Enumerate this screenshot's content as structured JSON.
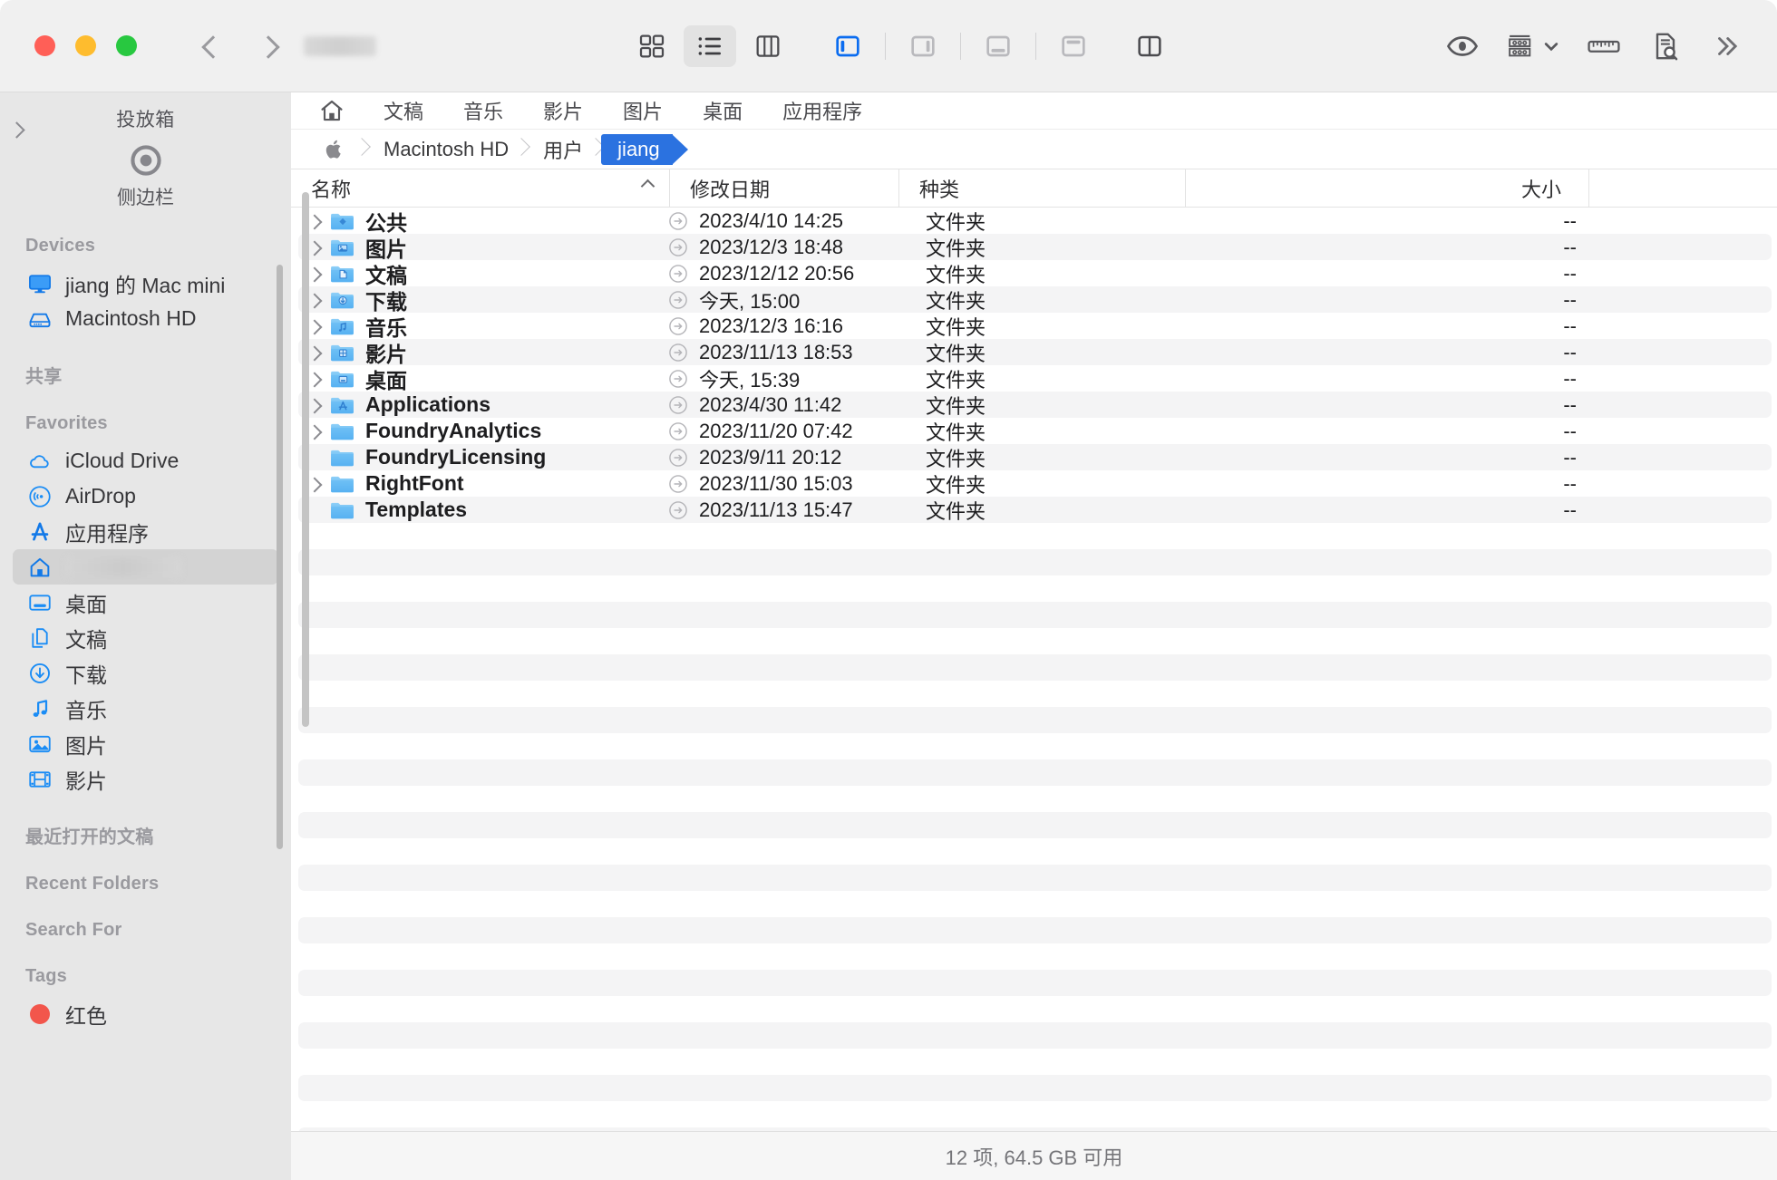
{
  "window": {
    "traffic_lights": [
      "close",
      "minimize",
      "zoom"
    ],
    "title_redacted": true
  },
  "toolbar": {
    "back_label": "后退",
    "forward_label": "前进",
    "view_buttons": [
      {
        "name": "icon-view",
        "label": "图标显示",
        "active": false
      },
      {
        "name": "list-view",
        "label": "列表显示",
        "active": true
      },
      {
        "name": "column-view",
        "label": "分栏显示",
        "active": false
      }
    ],
    "pane_buttons": [
      {
        "name": "sidebar-left-toggle",
        "label": "左侧边栏",
        "active": true
      },
      {
        "name": "sidebar-right-toggle",
        "label": "右侧边栏",
        "active": false
      },
      {
        "name": "bottom-pane-toggle",
        "label": "底部面板",
        "active": false
      },
      {
        "name": "top-pane-toggle",
        "label": "顶部面板",
        "active": false
      },
      {
        "name": "split-pane-toggle",
        "label": "双栏",
        "active": false
      }
    ],
    "right_buttons": [
      {
        "name": "quick-look",
        "label": "快速查看"
      },
      {
        "name": "group-by",
        "label": "分组方式"
      },
      {
        "name": "measure",
        "label": "标尺"
      },
      {
        "name": "document-search",
        "label": "文稿搜索"
      },
      {
        "name": "more",
        "label": "更多"
      }
    ]
  },
  "sidebar": {
    "dropbox_title": "投放箱",
    "dropbox_subtitle": "侧边栏",
    "sections": [
      {
        "title": "Devices",
        "items": [
          {
            "icon": "display-icon",
            "label": "jiang 的 Mac mini",
            "selected": false
          },
          {
            "icon": "harddisk-icon",
            "label": "Macintosh HD",
            "selected": false
          }
        ]
      },
      {
        "title": "共享",
        "items": []
      },
      {
        "title": "Favorites",
        "items": [
          {
            "icon": "cloud-icon",
            "label": "iCloud Drive",
            "selected": false
          },
          {
            "icon": "airdrop-icon",
            "label": "AirDrop",
            "selected": false
          },
          {
            "icon": "appstore-icon",
            "label": "应用程序",
            "selected": false
          },
          {
            "icon": "home-icon",
            "label": "",
            "selected": true,
            "redacted": true
          },
          {
            "icon": "desktop-icon",
            "label": "桌面",
            "selected": false
          },
          {
            "icon": "documents-icon",
            "label": "文稿",
            "selected": false
          },
          {
            "icon": "downloads-icon",
            "label": "下载",
            "selected": false
          },
          {
            "icon": "music-icon",
            "label": "音乐",
            "selected": false
          },
          {
            "icon": "pictures-icon",
            "label": "图片",
            "selected": false
          },
          {
            "icon": "movies-icon",
            "label": "影片",
            "selected": false
          }
        ]
      },
      {
        "title": "最近打开的文稿",
        "items": []
      },
      {
        "title": "Recent Folders",
        "items": []
      },
      {
        "title": "Search For",
        "items": []
      },
      {
        "title": "Tags",
        "items": [
          {
            "icon": "tag-dot-icon",
            "label": "红色",
            "color": "#f2564c",
            "selected": false
          }
        ]
      }
    ]
  },
  "favorites_bar": {
    "home_icon": "home-icon",
    "items": [
      "文稿",
      "音乐",
      "影片",
      "图片",
      "桌面",
      "应用程序"
    ]
  },
  "breadcrumb": {
    "items": [
      {
        "label": "",
        "icon": "apple-icon",
        "active": false
      },
      {
        "label": "Macintosh HD",
        "active": false
      },
      {
        "label": "用户",
        "active": false
      },
      {
        "label": "jiang",
        "active": true
      }
    ],
    "active_color": "#2b72e0"
  },
  "table": {
    "columns": [
      {
        "key": "name",
        "label": "名称",
        "sorted": true,
        "sort_direction": "asc"
      },
      {
        "key": "date",
        "label": "修改日期",
        "sorted": false
      },
      {
        "key": "kind",
        "label": "种类",
        "sorted": false
      },
      {
        "key": "size",
        "label": "大小",
        "sorted": false
      }
    ],
    "rows": [
      {
        "name": "公共",
        "icon": "folder-public-icon",
        "has_disclosure": true,
        "date": "2023/4/10 14:25",
        "kind": "文件夹",
        "size": "--"
      },
      {
        "name": "图片",
        "icon": "folder-pictures-icon",
        "has_disclosure": true,
        "date": "2023/12/3 18:48",
        "kind": "文件夹",
        "size": "--"
      },
      {
        "name": "文稿",
        "icon": "folder-documents-icon",
        "has_disclosure": true,
        "date": "2023/12/12 20:56",
        "kind": "文件夹",
        "size": "--"
      },
      {
        "name": "下载",
        "icon": "folder-downloads-icon",
        "has_disclosure": true,
        "date": "今天, 15:00",
        "kind": "文件夹",
        "size": "--"
      },
      {
        "name": "音乐",
        "icon": "folder-music-icon",
        "has_disclosure": true,
        "date": "2023/12/3 16:16",
        "kind": "文件夹",
        "size": "--"
      },
      {
        "name": "影片",
        "icon": "folder-movies-icon",
        "has_disclosure": true,
        "date": "2023/11/13 18:53",
        "kind": "文件夹",
        "size": "--"
      },
      {
        "name": "桌面",
        "icon": "folder-desktop-icon",
        "has_disclosure": true,
        "date": "今天, 15:39",
        "kind": "文件夹",
        "size": "--"
      },
      {
        "name": "Applications",
        "icon": "folder-applications-icon",
        "has_disclosure": true,
        "date": "2023/4/30 11:42",
        "kind": "文件夹",
        "size": "--"
      },
      {
        "name": "FoundryAnalytics",
        "icon": "folder-icon",
        "has_disclosure": true,
        "date": "2023/11/20 07:42",
        "kind": "文件夹",
        "size": "--"
      },
      {
        "name": "FoundryLicensing",
        "icon": "folder-icon",
        "has_disclosure": false,
        "date": "2023/9/11 20:12",
        "kind": "文件夹",
        "size": "--"
      },
      {
        "name": "RightFont",
        "icon": "folder-icon",
        "has_disclosure": true,
        "date": "2023/11/30 15:03",
        "kind": "文件夹",
        "size": "--"
      },
      {
        "name": "Templates",
        "icon": "folder-icon",
        "has_disclosure": false,
        "date": "2023/11/13 15:47",
        "kind": "文件夹",
        "size": "--"
      }
    ],
    "empty_row_count": 25
  },
  "statusbar": {
    "text": "12 项, 64.5 GB 可用"
  }
}
